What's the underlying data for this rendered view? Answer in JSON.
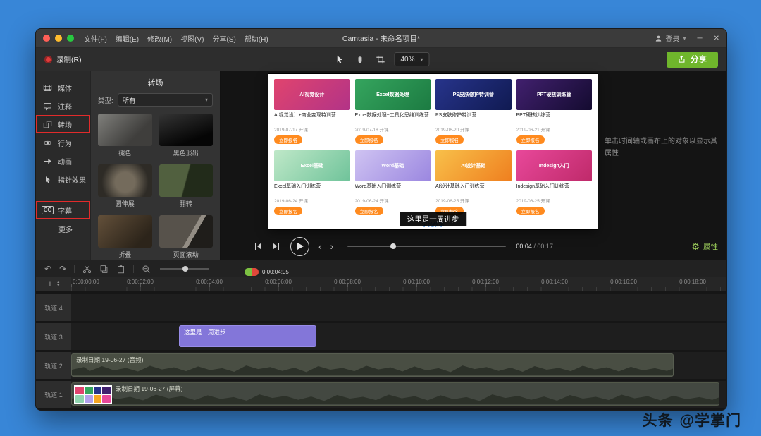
{
  "watermark": {
    "brand": "头条",
    "handle": "@学掌门"
  },
  "titlebar": {
    "menu": [
      "文件(F)",
      "编辑(E)",
      "修改(M)",
      "视图(V)",
      "分享(S)",
      "帮助(H)"
    ],
    "title": "Camtasia - 未命名项目*",
    "login": "登录"
  },
  "toolbar": {
    "record": "录制(R)",
    "zoom": "40%",
    "share": "分享"
  },
  "sidebar": {
    "cc_badge": "CC",
    "items": [
      {
        "label": "媒体"
      },
      {
        "label": "注释"
      },
      {
        "label": "转场"
      },
      {
        "label": "行为"
      },
      {
        "label": "动画"
      },
      {
        "label": "指针效果"
      },
      {
        "label": "字幕"
      },
      {
        "label": "更多"
      }
    ]
  },
  "transitions": {
    "title": "转场",
    "filter_label": "类型:",
    "filter_value": "所有",
    "items": [
      "褪色",
      "黑色淡出",
      "圆伸展",
      "翻转",
      "折叠",
      "页面滚动"
    ]
  },
  "preview": {
    "caption": "这里是一周进步",
    "hint": "单击时间轴或画布上的对象以显示其属性",
    "time_current": "00:04",
    "time_sep": "/",
    "time_total": "00:17",
    "properties": "属性"
  },
  "webpage": {
    "story_link": "学员故事",
    "cards": [
      {
        "banner": "AI视觉设计",
        "title": "AI视觉设计+商业变现特训营",
        "date": "2019-07-17 开课",
        "cta": "立即报名",
        "c1": "#e0446e",
        "c2": "#b23387"
      },
      {
        "banner": "Excel数据处理",
        "title": "Excel数据处理+工具化思维训练营",
        "date": "2019-07-18 开课",
        "cta": "立即报名",
        "c1": "#35a55e",
        "c2": "#1c7b42"
      },
      {
        "banner": "PS皮肤修护特训营",
        "title": "PS皮肤修护特训营",
        "date": "2019-06-20 开课",
        "cta": "立即报名",
        "c1": "#27348b",
        "c2": "#101a52"
      },
      {
        "banner": "PPT硬核训练营",
        "title": "PPT硬核训练营",
        "date": "2019-06-21 开课",
        "cta": "立即报名",
        "c1": "#41206e",
        "c2": "#140b30"
      },
      {
        "banner": "Excel基础",
        "title": "Excel基础入门训练营",
        "date": "2019-06-24 开课",
        "cta": "立即报名",
        "c1": "#bfe8c8",
        "c2": "#6fc39a"
      },
      {
        "banner": "Word基础",
        "title": "Word基础入门训练营",
        "date": "2019-06-24 开课",
        "cta": "立即报名",
        "c1": "#cfc3f2",
        "c2": "#9b87e0"
      },
      {
        "banner": "AI设计基础",
        "title": "AI设计基础入门训练营",
        "date": "2019-06-25 开课",
        "cta": "立即报名",
        "c1": "#f8c04a",
        "c2": "#ef7f1f"
      },
      {
        "banner": "Indesign入门",
        "title": "Indesign基础入门训练营",
        "date": "2019-06-25 开课",
        "cta": "立即报名",
        "c1": "#e8489a",
        "c2": "#bf2a6a"
      }
    ]
  },
  "timeline": {
    "playhead_time": "0:00:04:05",
    "ruler": [
      "0:00:00:00",
      "0:00:02:00",
      "0:00:04:00",
      "0:00:06:00",
      "0:00:08:00",
      "0:00:10:00",
      "0:00:12:00",
      "0:00:14:00",
      "0:00:16:00",
      "0:00:18:00"
    ],
    "tracks": [
      {
        "name": "轨道 4",
        "clip": ""
      },
      {
        "name": "轨道 3",
        "clip": "这里是一周进步"
      },
      {
        "name": "轨道 2",
        "clip": "录制日期 19-06-27 (音频)"
      },
      {
        "name": "轨道 1",
        "clip": "录制日期 19-06-27 (屏幕)"
      }
    ]
  },
  "colors": {
    "accent_green": "#6fb62c",
    "record_red": "#e03c3c",
    "clip_purple": "#8376d9",
    "annotation_red": "#e12b2b",
    "background_blue": "#3886d7",
    "cta_orange": "#ff8a1e"
  }
}
